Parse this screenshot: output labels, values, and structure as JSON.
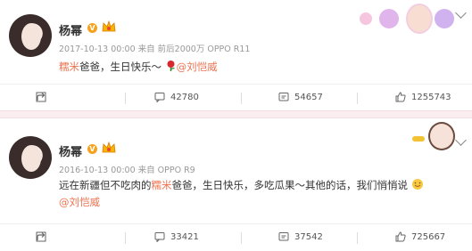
{
  "post1": {
    "name": "杨幂",
    "meta": "2017-10-13 00:00 来自 前后2000万 OPPO R11",
    "content_highlight": "糯米",
    "content_text": "爸爸，生日快乐～",
    "mention": "@刘恺威",
    "actions": {
      "forward": "",
      "comment": "42780",
      "repost": "54657",
      "like": "1255743"
    }
  },
  "post2": {
    "name": "杨幂",
    "meta": "2016-10-13 00:00 来自 OPPO R9",
    "content_pre": "远在新疆但不吃肉的",
    "content_highlight": "糯米",
    "content_post": "爸爸，生日快乐，多吃瓜果～其他的话，我们悄悄说",
    "mention": "@刘恺威",
    "actions": {
      "forward": "",
      "comment": "33421",
      "repost": "37542",
      "like": "725667"
    }
  },
  "colors": {
    "highlight": "#eb7350",
    "separator": "#fbeef1",
    "badge": "#f6a21e"
  },
  "icons": [
    "avatar",
    "verified-icon",
    "crown-icon",
    "rose-icon",
    "share-icon",
    "comment-icon",
    "repost-icon",
    "like-icon",
    "chevron-down-icon",
    "emoji-icon"
  ]
}
